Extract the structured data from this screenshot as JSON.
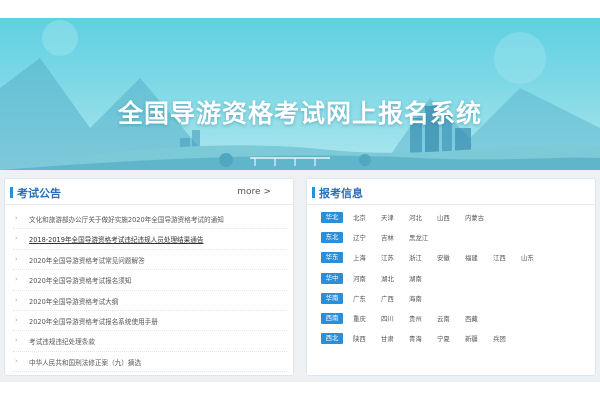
{
  "banner": {
    "title": "全国导游资格考试网上报名系统"
  },
  "notice_panel": {
    "title": "考试公告",
    "more_label": "more >",
    "items": [
      "文化和旅游部办公厅关于做好实施2020年全国导游资格考试的通知",
      "2018-2019年全国导游资格考试违纪违规人员处理结果通告",
      "2020年全国导游资格考试常见问题解答",
      "2020年全国导游资格考试报名须知",
      "2020年全国导游资格考试大纲",
      "2020年全国导游资格考试报名系统使用手册",
      "考试违规违纪处理条款",
      "中华人民共和国刑法修正案（九）摘选"
    ]
  },
  "info_panel": {
    "title": "报考信息",
    "regions": [
      {
        "label": "华北",
        "provinces": [
          "北京",
          "天津",
          "河北",
          "山西",
          "内蒙古"
        ]
      },
      {
        "label": "东北",
        "provinces": [
          "辽宁",
          "吉林",
          "黑龙江"
        ]
      },
      {
        "label": "华东",
        "provinces": [
          "上海",
          "江苏",
          "浙江",
          "安徽",
          "福建",
          "江西",
          "山东"
        ]
      },
      {
        "label": "华中",
        "provinces": [
          "河南",
          "湖北",
          "湖南"
        ]
      },
      {
        "label": "华南",
        "provinces": [
          "广东",
          "广西",
          "海南"
        ]
      },
      {
        "label": "西南",
        "provinces": [
          "重庆",
          "四川",
          "贵州",
          "云南",
          "西藏"
        ]
      },
      {
        "label": "西北",
        "provinces": [
          "陕西",
          "甘肃",
          "青海",
          "宁夏",
          "新疆",
          "兵团"
        ]
      }
    ]
  },
  "colors": {
    "accent": "#2a8fd8",
    "title_blue": "#2a6fb7",
    "banner_sky": "#6fd4e4"
  }
}
